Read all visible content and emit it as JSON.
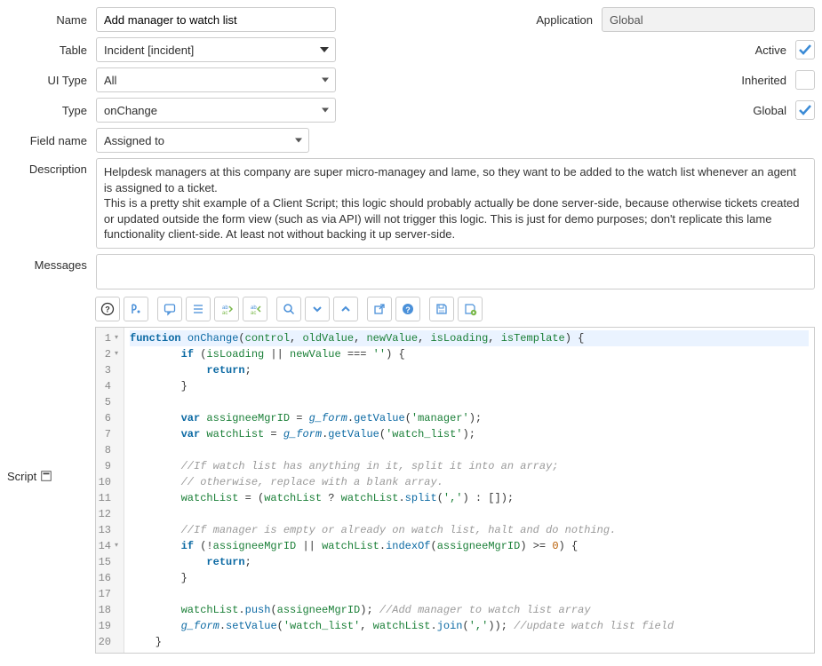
{
  "fields": {
    "name_label": "Name",
    "name_value": "Add manager to watch list",
    "application_label": "Application",
    "application_value": "Global",
    "table_label": "Table",
    "table_value": "Incident [incident]",
    "active_label": "Active",
    "active_checked": true,
    "ui_type_label": "UI Type",
    "ui_type_value": "All",
    "inherited_label": "Inherited",
    "inherited_checked": false,
    "type_label": "Type",
    "type_value": "onChange",
    "global_label": "Global",
    "global_checked": true,
    "field_name_label": "Field name",
    "field_name_value": "Assigned to",
    "description_label": "Description",
    "description_text": "Helpdesk managers at this company are super micro-managey and lame, so they want to be added to the watch list whenever an agent is assigned to a ticket.\nThis is a pretty shit example of a Client Script; this logic should probably actually be done server-side, because otherwise tickets created or updated outside the form view (such as via API) will not trigger this logic. This is just for demo purposes; don't replicate this lame functionality client-side. At least not without backing it up server-side.",
    "messages_label": "Messages",
    "messages_value": "",
    "script_label": "Script"
  },
  "toolbar_icons": [
    "help",
    "format",
    "comment",
    "indent",
    "replace-forward",
    "replace-back",
    "search",
    "expand",
    "collapse",
    "open-window",
    "info",
    "save",
    "save-run"
  ],
  "code": {
    "lines": [
      {
        "n": 1,
        "fold": true,
        "tokens": "function onChange(control, oldValue, newValue, isLoading, isTemplate) {"
      },
      {
        "n": 2,
        "fold": true,
        "tokens": "        if (isLoading || newValue === '') {"
      },
      {
        "n": 3,
        "fold": false,
        "tokens": "            return;"
      },
      {
        "n": 4,
        "fold": false,
        "tokens": "        }"
      },
      {
        "n": 5,
        "fold": false,
        "tokens": ""
      },
      {
        "n": 6,
        "fold": false,
        "tokens": "        var assigneeMgrID = g_form.getValue('manager');"
      },
      {
        "n": 7,
        "fold": false,
        "tokens": "        var watchList = g_form.getValue('watch_list');"
      },
      {
        "n": 8,
        "fold": false,
        "tokens": ""
      },
      {
        "n": 9,
        "fold": false,
        "tokens": "        //If watch list has anything in it, split it into an array;"
      },
      {
        "n": 10,
        "fold": false,
        "tokens": "        // otherwise, replace with a blank array."
      },
      {
        "n": 11,
        "fold": false,
        "tokens": "        watchList = (watchList ? watchList.split(',') : []);"
      },
      {
        "n": 12,
        "fold": false,
        "tokens": ""
      },
      {
        "n": 13,
        "fold": false,
        "tokens": "        //If manager is empty or already on watch list, halt and do nothing."
      },
      {
        "n": 14,
        "fold": true,
        "tokens": "        if (!assigneeMgrID || watchList.indexOf(assigneeMgrID) >= 0) {"
      },
      {
        "n": 15,
        "fold": false,
        "tokens": "            return;"
      },
      {
        "n": 16,
        "fold": false,
        "tokens": "        }"
      },
      {
        "n": 17,
        "fold": false,
        "tokens": ""
      },
      {
        "n": 18,
        "fold": false,
        "tokens": "        watchList.push(assigneeMgrID); //Add manager to watch list array"
      },
      {
        "n": 19,
        "fold": false,
        "tokens": "        g_form.setValue('watch_list', watchList.join(',')); //update watch list field"
      },
      {
        "n": 20,
        "fold": false,
        "tokens": "    }"
      }
    ]
  }
}
